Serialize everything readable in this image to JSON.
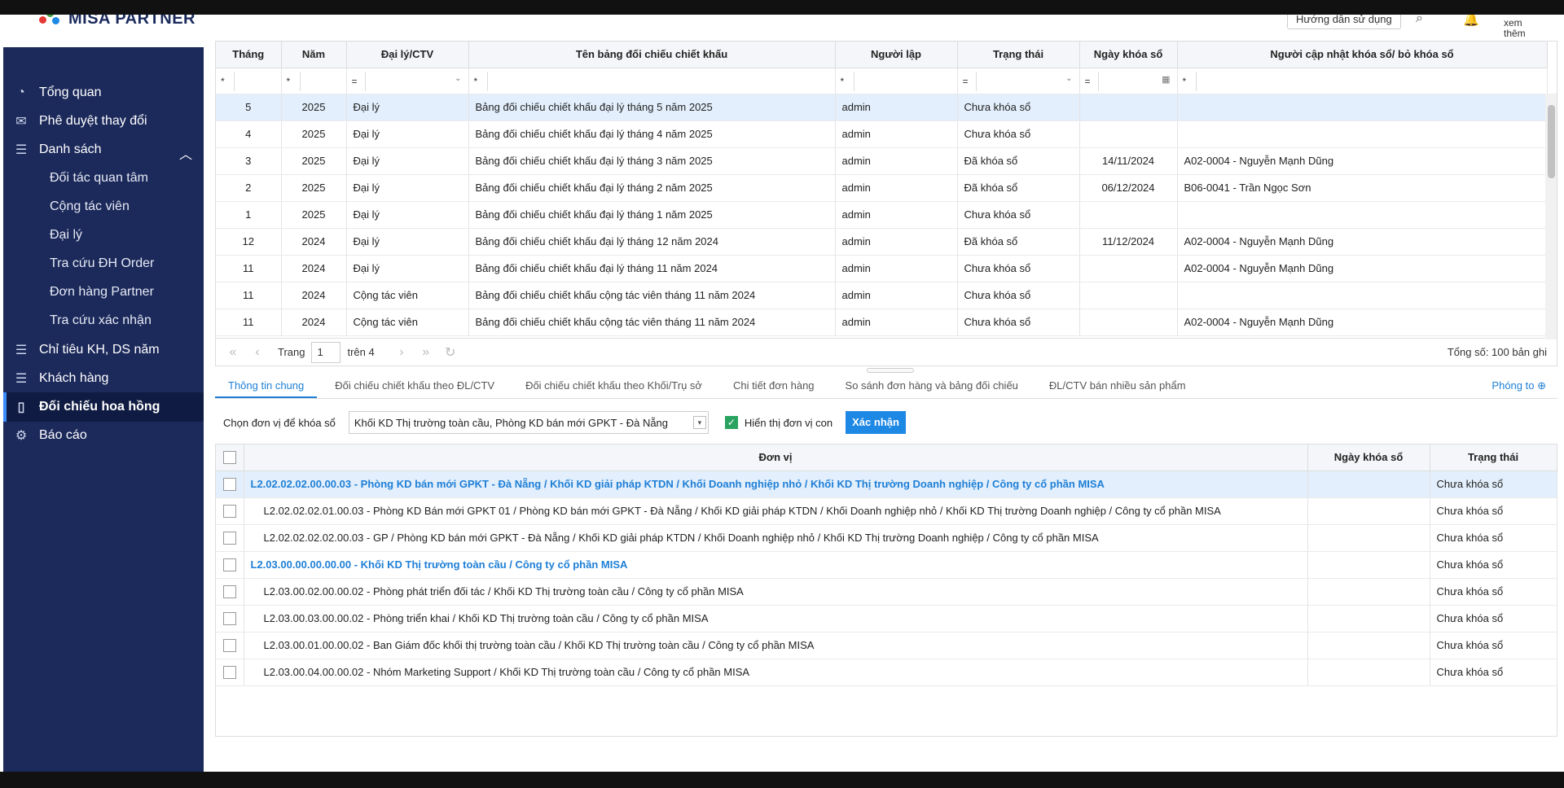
{
  "header": {
    "brand": "MISA PARTNER",
    "guide_label": "Hướng dẫn sử dụng",
    "more_label": "xem thêm",
    "search_icon": "search-icon",
    "bell_icon": "bell-icon"
  },
  "sidebar": {
    "items": [
      {
        "label": "Tổng quan",
        "icon": "dashboard-icon"
      },
      {
        "label": "Phê duyệt thay đổi",
        "icon": "mail-icon"
      },
      {
        "label": "Danh sách",
        "icon": "list-icon"
      },
      {
        "label": "Đối tác quan tâm"
      },
      {
        "label": "Cộng tác viên"
      },
      {
        "label": "Đại lý"
      },
      {
        "label": "Tra cứu ĐH Order"
      },
      {
        "label": "Đơn hàng Partner"
      },
      {
        "label": "Tra cứu xác nhận"
      },
      {
        "label": "Chỉ tiêu KH, DS năm",
        "icon": "list-icon"
      },
      {
        "label": "Khách hàng",
        "icon": "list-icon"
      },
      {
        "label": "Đối chiếu hoa hồng",
        "icon": "book-icon"
      },
      {
        "label": "Báo cáo",
        "icon": "report-icon"
      }
    ]
  },
  "grid1": {
    "columns": [
      "Tháng",
      "Năm",
      "Đại lý/CTV",
      "Tên bảng đối chiếu chiết khấu",
      "Người lập",
      "Trạng thái",
      "Ngày khóa sổ",
      "Người cập nhật khóa sổ/ bỏ khóa sổ"
    ],
    "filter_ops": [
      "*",
      "*",
      "=",
      "*",
      "*",
      "=",
      "=",
      "*"
    ],
    "rows": [
      [
        "5",
        "2025",
        "Đại lý",
        "Bảng đối chiếu chiết khấu đại lý tháng 5 năm 2025",
        "admin",
        "Chưa khóa sổ",
        "",
        ""
      ],
      [
        "4",
        "2025",
        "Đại lý",
        "Bảng đối chiếu chiết khấu đại lý tháng 4 năm 2025",
        "admin",
        "Chưa khóa sổ",
        "",
        ""
      ],
      [
        "3",
        "2025",
        "Đại lý",
        "Bảng đối chiếu chiết khấu đại lý tháng 3 năm 2025",
        "admin",
        "Đã khóa sổ",
        "14/11/2024",
        "A02-0004 - Nguyễn Mạnh Dũng"
      ],
      [
        "2",
        "2025",
        "Đại lý",
        "Bảng đối chiếu chiết khấu đại lý tháng 2 năm 2025",
        "admin",
        "Đã khóa sổ",
        "06/12/2024",
        "B06-0041 - Trần Ngọc Sơn"
      ],
      [
        "1",
        "2025",
        "Đại lý",
        "Bảng đối chiếu chiết khấu đại lý tháng 1 năm 2025",
        "admin",
        "Chưa khóa sổ",
        "",
        ""
      ],
      [
        "12",
        "2024",
        "Đại lý",
        "Bảng đối chiếu chiết khấu đại lý tháng 12 năm 2024",
        "admin",
        "Đã khóa sổ",
        "11/12/2024",
        "A02-0004 - Nguyễn Mạnh Dũng"
      ],
      [
        "11",
        "2024",
        "Đại lý",
        "Bảng đối chiếu chiết khấu đại lý tháng 11 năm 2024",
        "admin",
        "Chưa khóa sổ",
        "",
        "A02-0004 - Nguyễn Mạnh Dũng"
      ],
      [
        "11",
        "2024",
        "Cộng tác viên",
        "Bảng đối chiếu chiết khấu cộng tác viên tháng 11 năm 2024",
        "admin",
        "Chưa khóa sổ",
        "",
        ""
      ],
      [
        "11",
        "2024",
        "Cộng tác viên",
        "Bảng đối chiếu chiết khấu cộng tác viên tháng 11 năm 2024",
        "admin",
        "Chưa khóa sổ",
        "",
        "A02-0004 - Nguyễn Mạnh Dũng"
      ]
    ]
  },
  "pager": {
    "page_label": "Trang",
    "page_value": "1",
    "of_label": "trên 4",
    "total": "Tổng số: 100 bản ghi"
  },
  "tabs": [
    "Thông tin chung",
    "Đối chiếu chiết khấu theo ĐL/CTV",
    "Đối chiếu chiết khấu theo Khối/Trụ sở",
    "Chi tiết đơn hàng",
    "So sánh đơn hàng và bảng đối chiếu",
    "ĐL/CTV bán nhiều sản phẩm"
  ],
  "zoom_label": "Phóng to",
  "toolbar": {
    "unit_label": "Chọn đơn vị để khóa sổ",
    "unit_value": "Khối KD Thị trường toàn cầu, Phòng KD bán mới GPKT - Đà Nẵng",
    "show_children_label": "Hiển thị đơn vị con",
    "confirm_label": "Xác nhận"
  },
  "grid2": {
    "columns": [
      "Đơn vị",
      "Ngày khóa sổ",
      "Trạng thái"
    ],
    "rows": [
      {
        "unit": "L2.02.02.02.00.00.03 - Phòng KD bán mới GPKT - Đà Nẵng / Khối KD giải pháp KTDN / Khối Doanh nghiệp nhỏ / Khối KD Thị trường Doanh nghiệp / Công ty cổ phần MISA",
        "date": "",
        "status": "Chưa khóa sổ",
        "group": true
      },
      {
        "unit": "L2.02.02.02.01.00.03 - Phòng KD Bán mới GPKT 01 / Phòng KD bán mới GPKT - Đà Nẵng / Khối KD giải pháp KTDN / Khối Doanh nghiệp nhỏ / Khối KD Thị trường Doanh nghiệp / Công ty cổ phần MISA",
        "date": "",
        "status": "Chưa khóa sổ",
        "group": false
      },
      {
        "unit": "L2.02.02.02.02.00.03 - GP / Phòng KD bán mới GPKT - Đà Nẵng / Khối KD giải pháp KTDN / Khối Doanh nghiệp nhỏ / Khối KD Thị trường Doanh nghiệp / Công ty cổ phần MISA",
        "date": "",
        "status": "Chưa khóa sổ",
        "group": false
      },
      {
        "unit": "L2.03.00.00.00.00.00 - Khối KD Thị trường toàn cầu / Công ty cổ phần MISA",
        "date": "",
        "status": "Chưa khóa sổ",
        "group": true
      },
      {
        "unit": "L2.03.00.02.00.00.02 - Phòng phát triển đối tác / Khối KD Thị trường toàn cầu / Công ty cổ phần MISA",
        "date": "",
        "status": "Chưa khóa sổ",
        "group": false
      },
      {
        "unit": "L2.03.00.03.00.00.02 - Phòng triển khai / Khối KD Thị trường toàn cầu / Công ty cổ phần MISA",
        "date": "",
        "status": "Chưa khóa sổ",
        "group": false
      },
      {
        "unit": "L2.03.00.01.00.00.02 - Ban Giám đốc khối thị trường toàn cầu / Khối KD Thị trường toàn cầu / Công ty cổ phần MISA",
        "date": "",
        "status": "Chưa khóa sổ",
        "group": false
      },
      {
        "unit": "L2.03.00.04.00.00.02 - Nhóm Marketing Support / Khối KD Thị trường toàn cầu / Công ty cổ phần MISA",
        "date": "",
        "status": "Chưa khóa sổ",
        "group": false
      }
    ]
  }
}
